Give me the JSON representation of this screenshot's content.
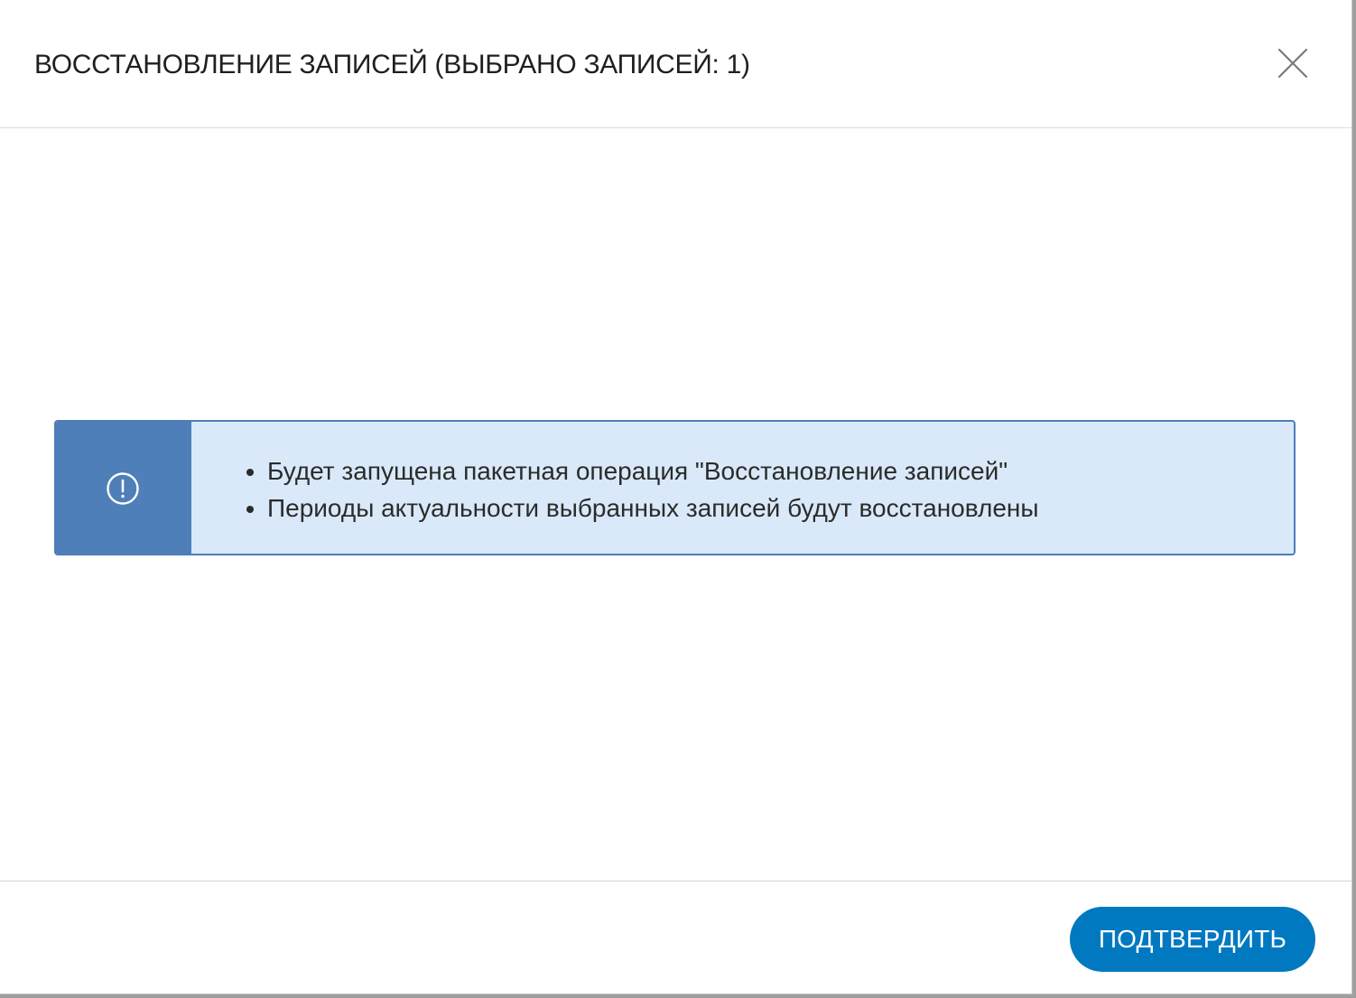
{
  "dialog": {
    "title": "ВОССТАНОВЛЕНИЕ ЗАПИСЕЙ (ВЫБРАНО ЗАПИСЕЙ: 1)",
    "close_icon": "close-icon"
  },
  "notice": {
    "icon": "info-circle-icon",
    "accent_color": "#4f7fb8",
    "background_color": "#d9e9f9",
    "items": [
      "Будет запущена пакетная операция \"Восстановление записей\"",
      "Периоды актуальности выбранных записей будут восстановлены"
    ]
  },
  "footer": {
    "confirm_label": "ПОДТВЕРДИТЬ",
    "confirm_color": "#0079c1"
  }
}
